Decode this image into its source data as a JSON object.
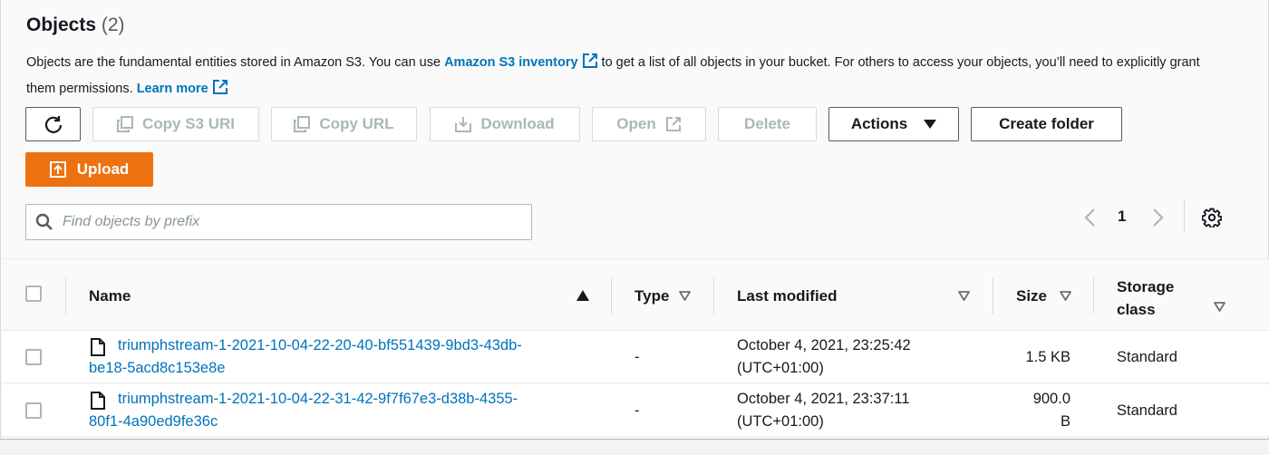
{
  "header": {
    "title": "Objects",
    "count": "(2)",
    "desc_part1": "Objects are the fundamental entities stored in Amazon S3. You can use ",
    "desc_link1": "Amazon S3 inventory",
    "desc_part2": " to get a list of all objects in your bucket. For others to access your objects, you’ll need to explicitly grant them permissions. ",
    "desc_link2": "Learn more"
  },
  "toolbar": {
    "copy_s3_uri": "Copy S3 URI",
    "copy_url": "Copy URL",
    "download": "Download",
    "open": "Open",
    "delete": "Delete",
    "actions": "Actions",
    "create_folder": "Create folder",
    "upload": "Upload"
  },
  "search": {
    "placeholder": "Find objects by prefix"
  },
  "pagination": {
    "page": "1"
  },
  "table": {
    "columns": {
      "name": "Name",
      "type": "Type",
      "last_modified": "Last modified",
      "size": "Size",
      "storage_class_1": "Storage",
      "storage_class_2": "class"
    },
    "rows": [
      {
        "name_line1": "triumphstream-1-2021-10-04-22-20-40-bf551439-9bd3-43db-",
        "name_line2": "be18-5acd8c153e8e",
        "type": "-",
        "modified_line1": "October 4, 2021, 23:25:42",
        "modified_line2": "(UTC+01:00)",
        "size_line1": "1.5 KB",
        "size_line2": "",
        "storage_class": "Standard"
      },
      {
        "name_line1": "triumphstream-1-2021-10-04-22-31-42-9f7f67e3-d38b-4355-",
        "name_line2": "80f1-4a90ed9fe36c",
        "type": "-",
        "modified_line1": "October 4, 2021, 23:37:11",
        "modified_line2": "(UTC+01:00)",
        "size_line1": "900.0",
        "size_line2": "B",
        "storage_class": "Standard"
      }
    ]
  },
  "icons": {
    "refresh": "refresh-icon",
    "copy": "copy-icon",
    "download": "download-icon",
    "external": "external-link-icon",
    "dropdown": "caret-down-icon",
    "upload": "upload-icon",
    "search": "search-icon",
    "prev": "chevron-left-icon",
    "next": "chevron-right-icon",
    "settings": "gear-icon",
    "file": "file-icon"
  },
  "colors": {
    "link": "#0073bb",
    "primary": "#ec7211",
    "disabled": "#aab7b8",
    "text": "#16191f"
  }
}
